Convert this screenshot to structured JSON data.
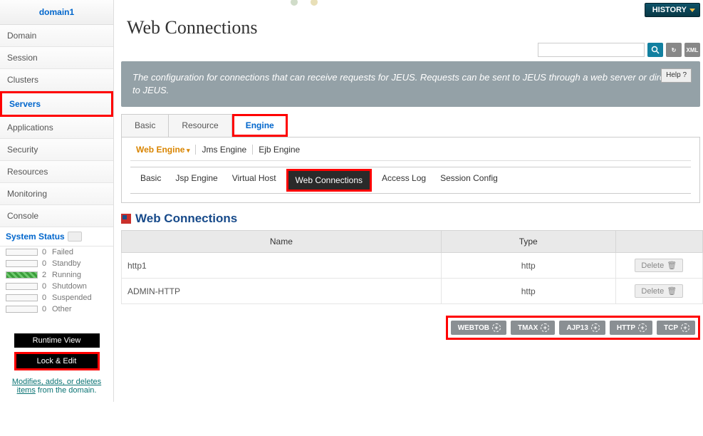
{
  "sidebar": {
    "domain": "domain1",
    "items": [
      "Domain",
      "Session",
      "Clusters",
      "Servers",
      "Applications",
      "Security",
      "Resources",
      "Monitoring",
      "Console"
    ],
    "active_index": 3,
    "status_header": "System Status",
    "status": [
      {
        "count": 0,
        "label": "Failed",
        "green": false
      },
      {
        "count": 0,
        "label": "Standby",
        "green": false
      },
      {
        "count": 2,
        "label": "Running",
        "green": true
      },
      {
        "count": 0,
        "label": "Shutdown",
        "green": false
      },
      {
        "count": 0,
        "label": "Suspended",
        "green": false
      },
      {
        "count": 0,
        "label": "Other",
        "green": false
      }
    ],
    "runtime_btn": "Runtime View",
    "lock_btn": "Lock & Edit",
    "modifies_link": "Modifies, adds, or deletes items",
    "modifies_tail": " from the domain."
  },
  "header": {
    "history": "HISTORY",
    "title": "Web Connections",
    "search_placeholder": "",
    "xml_label": "XML"
  },
  "info": {
    "text": "The configuration for connections that can receive requests for JEUS. Requests can be sent to JEUS through a web server or directly to JEUS.",
    "help": "Help ?"
  },
  "tabs": {
    "items": [
      "Basic",
      "Resource",
      "Engine"
    ],
    "active_index": 2
  },
  "subtabs": {
    "items": [
      "Web Engine",
      "Jms Engine",
      "Ejb Engine"
    ],
    "active_index": 0
  },
  "engtabs": {
    "items": [
      "Basic",
      "Jsp Engine",
      "Virtual Host",
      "Web Connections",
      "Access Log",
      "Session Config"
    ],
    "active_index": 3
  },
  "section": {
    "title": "Web Connections"
  },
  "table": {
    "cols": [
      "Name",
      "Type",
      ""
    ],
    "rows": [
      {
        "name": "http1",
        "type": "http",
        "delete": "Delete"
      },
      {
        "name": "ADMIN-HTTP",
        "type": "http",
        "delete": "Delete"
      }
    ]
  },
  "actions": [
    "WEBTOB",
    "TMAX",
    "AJP13",
    "HTTP",
    "TCP"
  ]
}
